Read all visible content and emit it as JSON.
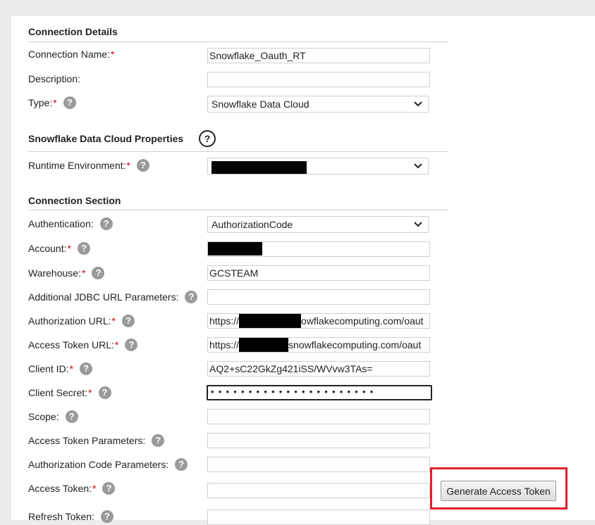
{
  "sections": {
    "connection_details": "Connection Details",
    "properties": "Snowflake Data Cloud Properties",
    "connection_section": "Connection Section"
  },
  "fields": {
    "connection_name": {
      "label": "Connection Name:",
      "required": "*",
      "value": "Snowflake_Oauth_RT"
    },
    "description": {
      "label": "Description:",
      "value": ""
    },
    "type": {
      "label": "Type:",
      "required": "*",
      "value": "Snowflake Data Cloud"
    },
    "runtime_environment": {
      "label": "Runtime Environment:",
      "required": "*"
    },
    "authentication": {
      "label": "Authentication:",
      "value": "AuthorizationCode"
    },
    "account": {
      "label": "Account:",
      "required": "*"
    },
    "warehouse": {
      "label": "Warehouse:",
      "required": "*",
      "value": "GCSTEAM"
    },
    "jdbc_params": {
      "label": "Additional JDBC URL Parameters:",
      "value": ""
    },
    "authorization_url": {
      "label": "Authorization URL:",
      "required": "*",
      "prefix": "https://",
      "suffix": "owflakecomputing.com/oaut"
    },
    "access_token_url": {
      "label": "Access Token URL:",
      "required": "*",
      "prefix": "https://",
      "suffix": "snowflakecomputing.com/oaut"
    },
    "client_id": {
      "label": "Client ID:",
      "required": "*",
      "value": "AQ2+sC22GkZg421iSS/WVvw3TAs="
    },
    "client_secret": {
      "label": "Client Secret:",
      "required": "*",
      "value": "••••••••••••••••••••••"
    },
    "scope": {
      "label": "Scope:",
      "value": ""
    },
    "access_token_params": {
      "label": "Access Token Parameters:",
      "value": ""
    },
    "auth_code_params": {
      "label": "Authorization Code Parameters:",
      "value": ""
    },
    "access_token": {
      "label": "Access Token:",
      "required": "*",
      "value": ""
    },
    "refresh_token": {
      "label": "Refresh Token:",
      "value": ""
    }
  },
  "buttons": {
    "generate_access_token": "Generate Access Token"
  },
  "icons": {
    "help": "?"
  },
  "colors": {
    "required": "#d0021b",
    "highlight": "#e0202a"
  }
}
